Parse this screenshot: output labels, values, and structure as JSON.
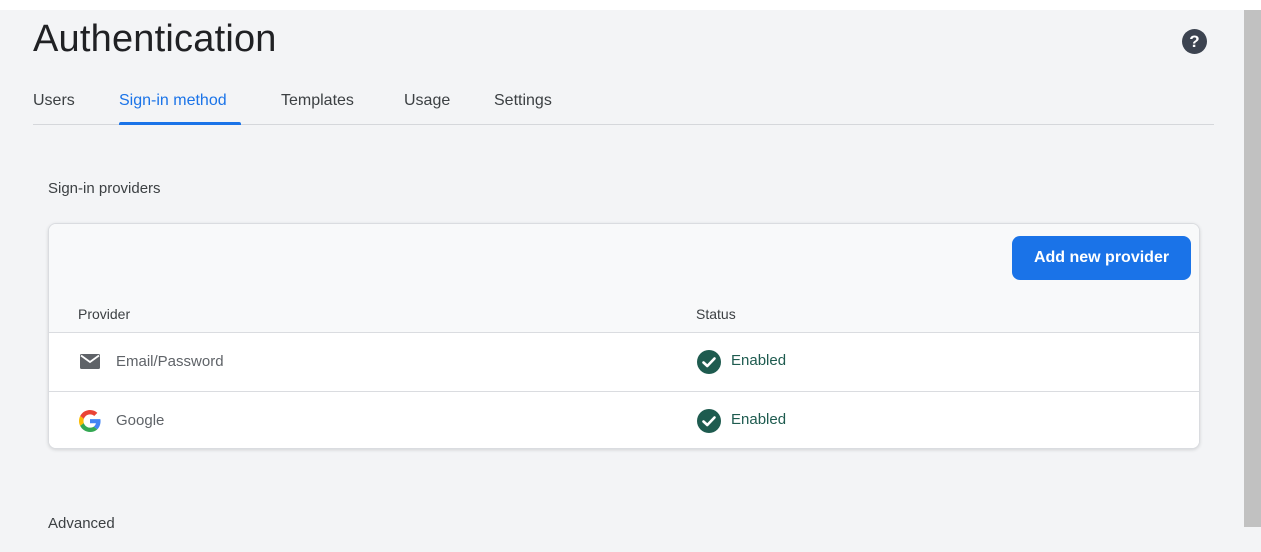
{
  "header": {
    "title": "Authentication",
    "help_icon": "help-circle-icon"
  },
  "tabs": [
    {
      "label": "Users",
      "active": false
    },
    {
      "label": "Sign-in method",
      "active": true
    },
    {
      "label": "Templates",
      "active": false
    },
    {
      "label": "Usage",
      "active": false
    },
    {
      "label": "Settings",
      "active": false
    }
  ],
  "sign_in_providers": {
    "section_title": "Sign-in providers",
    "add_button_label": "Add new provider",
    "columns": {
      "provider": "Provider",
      "status": "Status"
    },
    "rows": [
      {
        "provider": "Email/Password",
        "icon": "mail-icon",
        "status": "Enabled",
        "status_icon": "check-circle-icon"
      },
      {
        "provider": "Google",
        "icon": "google-icon",
        "status": "Enabled",
        "status_icon": "check-circle-icon"
      }
    ]
  },
  "advanced": {
    "section_title": "Advanced"
  },
  "colors": {
    "accent": "#1a73e8",
    "enabled": "#1e5b4f",
    "background": "#f3f4f6"
  }
}
